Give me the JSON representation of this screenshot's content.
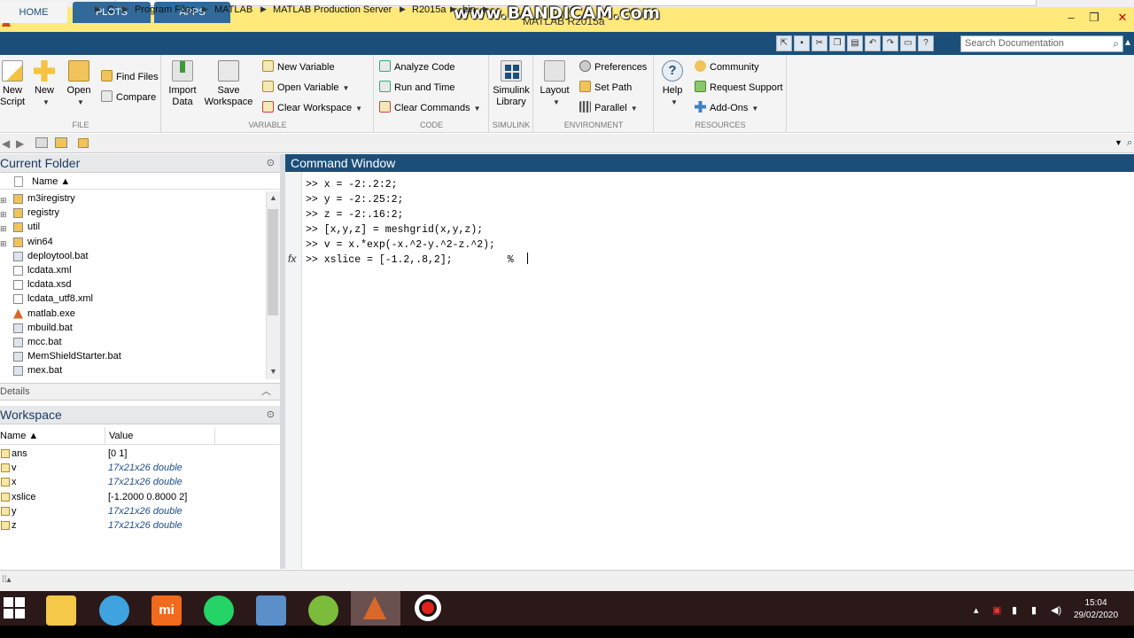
{
  "window": {
    "title": "MATLAB R2015a",
    "watermark": "www.BANDICAM.com"
  },
  "tabs": [
    {
      "label": "HOME"
    },
    {
      "label": "PLOTS"
    },
    {
      "label": "APPS"
    }
  ],
  "search": {
    "placeholder": "Search Documentation"
  },
  "ribbon": {
    "file": {
      "group_label": "FILE",
      "new_script": [
        "New",
        "Script"
      ],
      "new": "New",
      "open": "Open",
      "find_files": "Find Files",
      "compare": "Compare"
    },
    "variable": {
      "group_label": "VARIABLE",
      "import_data": [
        "Import",
        "Data"
      ],
      "save_workspace": [
        "Save",
        "Workspace"
      ],
      "new_variable": "New Variable",
      "open_variable": "Open Variable",
      "clear_workspace": "Clear Workspace"
    },
    "code": {
      "group_label": "CODE",
      "analyze_code": "Analyze Code",
      "run_and_time": "Run and Time",
      "clear_commands": "Clear Commands"
    },
    "simulink": {
      "group_label": "SIMULINK",
      "simulink_library": [
        "Simulink",
        "Library"
      ]
    },
    "environment": {
      "group_label": "ENVIRONMENT",
      "layout": "Layout",
      "preferences": "Preferences",
      "set_path": "Set Path",
      "parallel": "Parallel"
    },
    "resources": {
      "group_label": "RESOURCES",
      "help": "Help",
      "community": "Community",
      "request_support": "Request Support",
      "add_ons": "Add-Ons"
    }
  },
  "address": {
    "crumbs": [
      "C:",
      "Program Files",
      "MATLAB",
      "MATLAB Production Server",
      "R2015a",
      "bin"
    ]
  },
  "current_folder": {
    "title": "Current Folder",
    "column": "Name ▲",
    "items": [
      {
        "name": "m3iregistry",
        "type": "folder"
      },
      {
        "name": "registry",
        "type": "folder"
      },
      {
        "name": "util",
        "type": "folder"
      },
      {
        "name": "win64",
        "type": "folder"
      },
      {
        "name": "deploytool.bat",
        "type": "bat"
      },
      {
        "name": "lcdata.xml",
        "type": "file"
      },
      {
        "name": "lcdata.xsd",
        "type": "file"
      },
      {
        "name": "lcdata_utf8.xml",
        "type": "file"
      },
      {
        "name": "matlab.exe",
        "type": "exe"
      },
      {
        "name": "mbuild.bat",
        "type": "bat"
      },
      {
        "name": "mcc.bat",
        "type": "bat"
      },
      {
        "name": "MemShieldStarter.bat",
        "type": "bat"
      },
      {
        "name": "mex.bat",
        "type": "bat"
      }
    ],
    "details_label": "Details"
  },
  "workspace": {
    "title": "Workspace",
    "col_name": "Name ▲",
    "col_value": "Value",
    "vars": [
      {
        "name": "ans",
        "value": "[0 1]",
        "italic": false
      },
      {
        "name": "v",
        "value": "17x21x26 double",
        "italic": true
      },
      {
        "name": "x",
        "value": "17x21x26 double",
        "italic": true
      },
      {
        "name": "xslice",
        "value": "[-1.2000 0.8000 2]",
        "italic": false
      },
      {
        "name": "y",
        "value": "17x21x26 double",
        "italic": true
      },
      {
        "name": "z",
        "value": "17x21x26 double",
        "italic": true
      }
    ]
  },
  "command_window": {
    "title": "Command Window",
    "lines": [
      ">> x = -2:.2:2;",
      ">> y = -2:.25:2;",
      ">> z = -2:.16:2;",
      ">> [x,y,z] = meshgrid(x,y,z);",
      ">> v = x.*exp(-x.^2-y.^2-z.^2);",
      ">> xslice = [-1.2,.8,2];         %"
    ],
    "fx_label": "fx"
  },
  "taskbar": {
    "time": "15:04",
    "date": "29/02/2020"
  }
}
